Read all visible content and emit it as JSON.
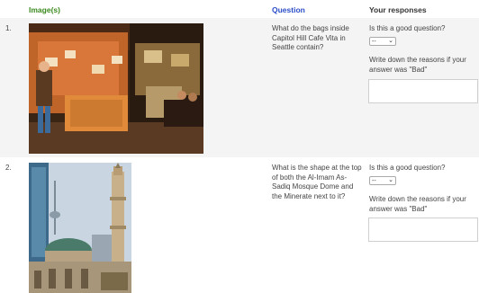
{
  "header": {
    "images": "Image(s)",
    "question": "Question",
    "responses": "Your responses"
  },
  "rows": [
    {
      "number": "1.",
      "question_lines": [
        "What do the bags inside",
        "Capitol Hill Cafe Vita in",
        "Seattle contain?"
      ],
      "good_question_label": "Is this a good question?",
      "select_value": "--",
      "reason_lines": [
        "Write down the reasons if your",
        "answer was \"Bad\""
      ],
      "reason_value": ""
    },
    {
      "number": "2.",
      "question_lines": [
        "What is the shape at the top",
        "of both the Al-Imam As-",
        "Sadiq Mosque Dome and",
        "the Minerate next to it?"
      ],
      "good_question_label": "Is this a good question?",
      "select_value": "--",
      "reason_lines": [
        "Write down the reasons if your",
        "answer was \"Bad\""
      ],
      "reason_value": ""
    }
  ],
  "colors": {
    "images_header": "#3a8a1e",
    "question_header": "#2a4cc9"
  },
  "icons": {
    "select_arrow": "chevron-down-icon"
  }
}
